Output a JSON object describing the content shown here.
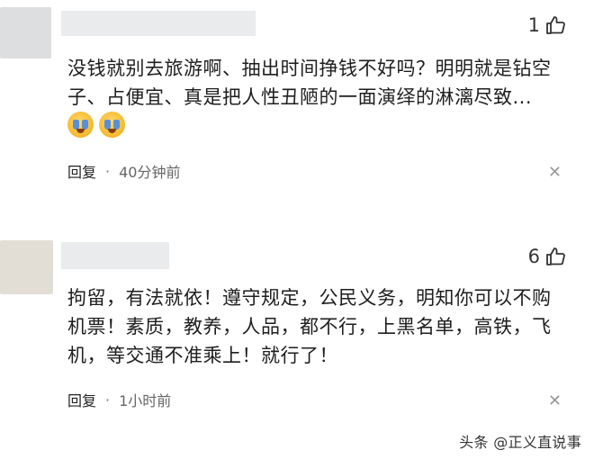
{
  "comments": [
    {
      "likes": "1",
      "text_lines": [
        "没钱就别去旅游啊、抽出时间挣钱不好吗？明明就是钻空",
        "子、占便宜、真是把人性丑陋的一面演绎的淋漓尽致..."
      ],
      "emojis": [
        "crying-face",
        "crying-face"
      ],
      "reply_label": "回复",
      "separator": "·",
      "time": "40分钟前",
      "close_glyph": "✕"
    },
    {
      "likes": "6",
      "text_lines": [
        "拘留，有法就依！遵守规定，公民义务，明知你可以不购",
        "机票！素质，教养，人品，都不行，上黑名单，高铁，飞",
        "机，等交通不准乘上！就行了！"
      ],
      "reply_label": "回复",
      "separator": "·",
      "time": "1小时前",
      "close_glyph": "✕"
    }
  ],
  "watermark": "头条 @正义直说事",
  "colors": {
    "text": "#1e1e1e",
    "meta": "#666666",
    "placeholder": "#e9ebec"
  }
}
